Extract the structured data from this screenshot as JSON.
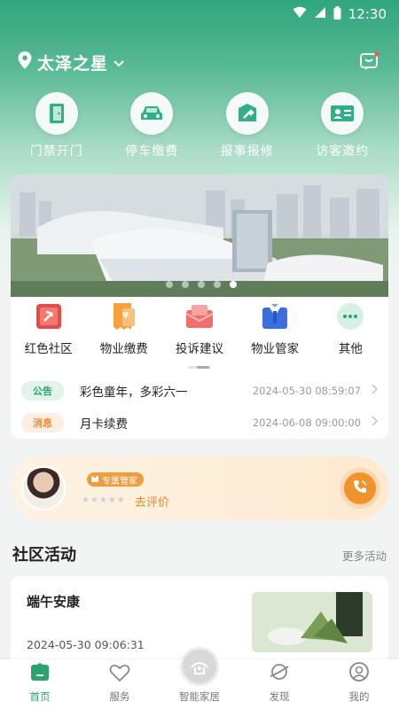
{
  "status_bar": {
    "time": "12:30"
  },
  "header": {
    "location": "太泽之星"
  },
  "quick_actions": [
    {
      "label": "门禁开门",
      "icon": "door-icon"
    },
    {
      "label": "停车缴费",
      "icon": "car-icon"
    },
    {
      "label": "报事报修",
      "icon": "wrench-icon"
    },
    {
      "label": "访客邀约",
      "icon": "visitor-card-icon"
    }
  ],
  "banner": {
    "active_slide": 4,
    "slide_count": 5
  },
  "services": [
    {
      "label": "红色社区",
      "icon": "party-flag-icon"
    },
    {
      "label": "物业缴费",
      "icon": "bill-icon"
    },
    {
      "label": "投诉建议",
      "icon": "mailbox-icon"
    },
    {
      "label": "物业管家",
      "icon": "butler-icon"
    },
    {
      "label": "其他",
      "icon": "more-icon"
    }
  ],
  "news": [
    {
      "tag": "公告",
      "title": "彩色童年，多彩六一",
      "time": "2024-05-30 08:59:07"
    },
    {
      "tag": "消息",
      "title": "月卡续费",
      "time": "2024-06-08 09:00:00"
    }
  ],
  "manager": {
    "badge": "专属管家",
    "rate_link": "去评价",
    "stars": "★★★★★",
    "rating": 0
  },
  "community": {
    "title": "社区活动",
    "more": "更多活动"
  },
  "activity": {
    "title": "端午安康",
    "date": "2024-05-30 09:06:31"
  },
  "tabbar": [
    {
      "label": "首页",
      "icon": "home-icon"
    },
    {
      "label": "服务",
      "icon": "heart-icon"
    },
    {
      "label": "智能家居",
      "icon": "smart-home-icon"
    },
    {
      "label": "发现",
      "icon": "planet-icon"
    },
    {
      "label": "我的",
      "icon": "profile-icon"
    }
  ],
  "colors": {
    "primary": "#2aa36f",
    "accent": "#f0922e"
  }
}
